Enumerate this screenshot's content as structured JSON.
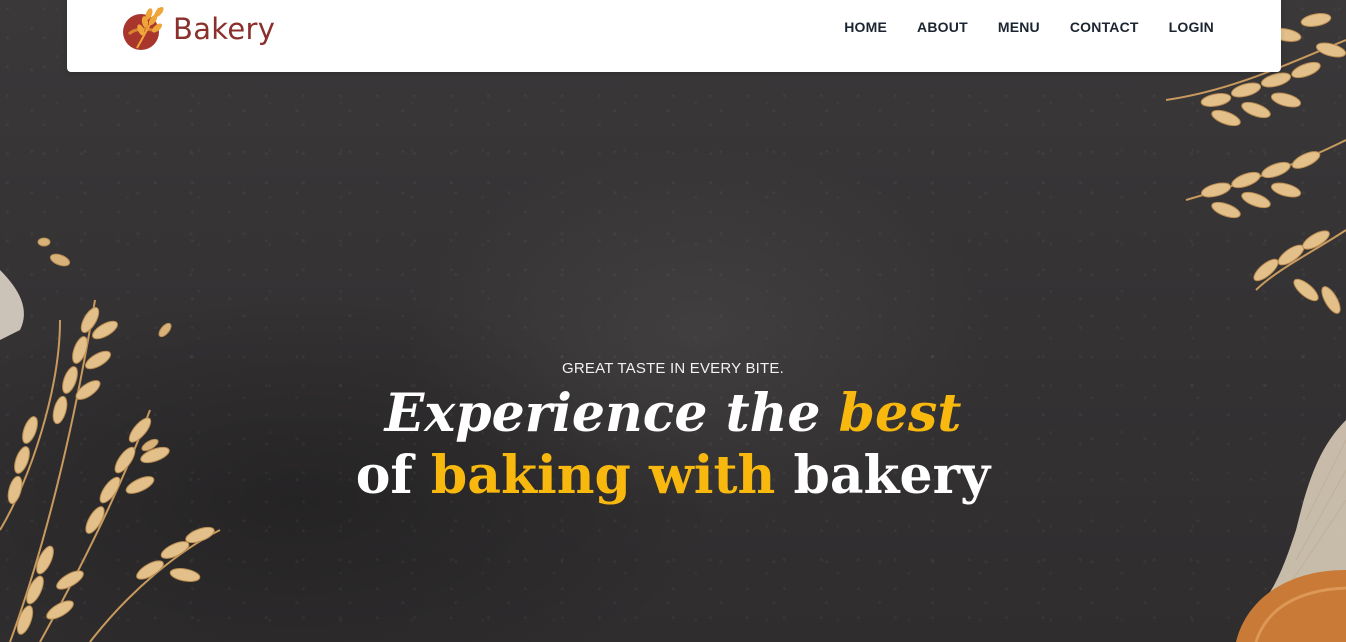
{
  "brand": {
    "name": "Bakery",
    "accent_color": "#8a2f2c",
    "logo_icon": "wheat-logo-icon"
  },
  "nav": {
    "items": [
      {
        "label": "HOME"
      },
      {
        "label": "ABOUT"
      },
      {
        "label": "MENU"
      },
      {
        "label": "CONTACT"
      },
      {
        "label": "LOGIN"
      }
    ]
  },
  "hero": {
    "tagline": "GREAT TASTE IN EVERY BITE.",
    "line1_part1": "Experience the ",
    "line1_accent": "best",
    "line2_part1": "of ",
    "line2_accent": "baking with",
    "line2_part2": " bakery",
    "accent_color": "#f8b80e",
    "background": "dark-slate-with-wheat"
  }
}
